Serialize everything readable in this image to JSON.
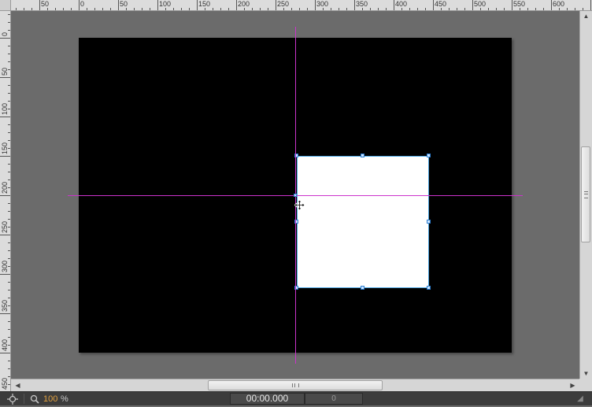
{
  "rulers": {
    "top_labels": [
      "50",
      "0",
      "50",
      "100",
      "150",
      "200",
      "250",
      "300",
      "350",
      "400",
      "450",
      "500",
      "550",
      "600"
    ],
    "left_labels": [
      "0",
      "50",
      "100",
      "150",
      "200",
      "250",
      "300",
      "350",
      "400",
      "450"
    ]
  },
  "canvas": {
    "background_color": "#000000",
    "shape_fill": "#ffffff",
    "guide_color": "#cc33cc",
    "selection_color": "#4aa3df"
  },
  "statusbar": {
    "snap_icon": "crosshair-icon",
    "zoom_icon": "magnifier-icon",
    "zoom_value": "100",
    "zoom_unit": "%",
    "time": "00:00.000",
    "frame": "0"
  }
}
